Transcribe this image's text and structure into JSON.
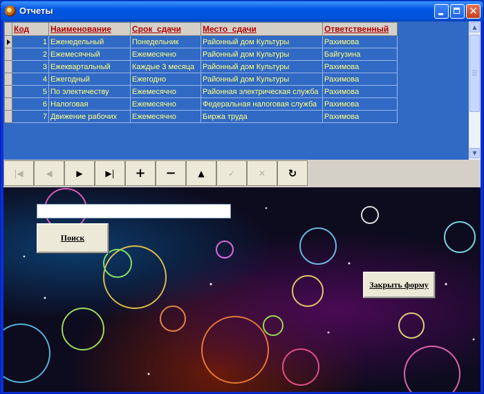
{
  "window": {
    "title": "Отчеты"
  },
  "grid": {
    "columns": [
      "Код",
      "Наименование",
      "Срок_сдачи",
      "Место_сдачи",
      "Ответственный"
    ],
    "rows": [
      {
        "code": "1",
        "name": "Еженедельный",
        "term": "Понедельник",
        "place": "Районный дом Культуры",
        "resp": "Рахимова"
      },
      {
        "code": "2",
        "name": "Ежемесячный",
        "term": "Ежемесячно",
        "place": "Районный дом Культуры",
        "resp": "Байгузина"
      },
      {
        "code": "3",
        "name": "Ежеквартальный",
        "term": "Каждые 3 месяца",
        "place": "Районный дом Культуры",
        "resp": "Рахимова"
      },
      {
        "code": "4",
        "name": "Ежегодный",
        "term": "Ежегодно",
        "place": "Районный дом Культуры",
        "resp": "Рахимова"
      },
      {
        "code": "5",
        "name": "По электичеству",
        "term": "Ежемесячно",
        "place": "Районная электрическая служба",
        "resp": "Рахимова"
      },
      {
        "code": "6",
        "name": "Налоговая",
        "term": "Ежемесячно",
        "place": "Федеральная налоговая служба",
        "resp": "Рахимова"
      },
      {
        "code": "7",
        "name": "Движение рабочих",
        "term": "Ежемесячно",
        "place": "Биржа труда",
        "resp": "Рахимова"
      }
    ]
  },
  "navigator": {
    "buttons": [
      {
        "name": "nav-first-button",
        "glyph": "|◀",
        "enabled": false
      },
      {
        "name": "nav-prior-button",
        "glyph": "◀",
        "enabled": false
      },
      {
        "name": "nav-next-button",
        "glyph": "▶",
        "enabled": true
      },
      {
        "name": "nav-last-button",
        "glyph": "▶|",
        "enabled": true
      },
      {
        "name": "nav-insert-button",
        "glyph": "+",
        "enabled": true
      },
      {
        "name": "nav-delete-button",
        "glyph": "−",
        "enabled": true
      },
      {
        "name": "nav-edit-button",
        "glyph": "▲",
        "enabled": true
      },
      {
        "name": "nav-post-button",
        "glyph": "✓",
        "enabled": false
      },
      {
        "name": "nav-cancel-button",
        "glyph": "✕",
        "enabled": false
      },
      {
        "name": "nav-refresh-button",
        "glyph": "↻",
        "enabled": true
      }
    ]
  },
  "search": {
    "value": "",
    "button_label": "Поиск"
  },
  "close_button_label": "Закрыть форму",
  "colors": {
    "grid_bg": "#316ac5",
    "grid_text": "#ffff80",
    "header_text": "#b00000"
  }
}
